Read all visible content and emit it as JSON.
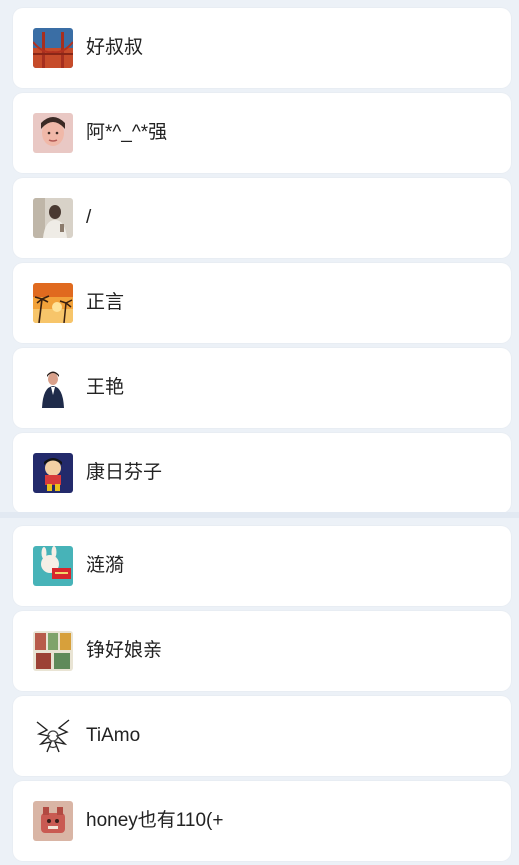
{
  "groups": [
    {
      "contacts": [
        {
          "name": "好叔叔",
          "avatar": "golden-gate-bridge-avatar"
        },
        {
          "name": "阿*^_^*强",
          "avatar": "portrait-avatar"
        },
        {
          "name": "/",
          "avatar": "person-photo-avatar"
        },
        {
          "name": "正言",
          "avatar": "palm-sunset-avatar"
        },
        {
          "name": "王艳",
          "avatar": "business-person-avatar"
        },
        {
          "name": "康日芬子",
          "avatar": "cartoon-character-avatar"
        }
      ]
    },
    {
      "contacts": [
        {
          "name": "涟漪",
          "avatar": "rabbit-sign-avatar"
        },
        {
          "name": "铮好娘亲",
          "avatar": "comic-strip-avatar"
        },
        {
          "name": "TiAmo",
          "avatar": "manga-sketch-avatar"
        },
        {
          "name": "honey也有110(+",
          "avatar": "toy-figure-avatar"
        }
      ]
    }
  ],
  "colors": {
    "background": "#ecf1f7",
    "card": "#ffffff",
    "text": "#222222"
  }
}
